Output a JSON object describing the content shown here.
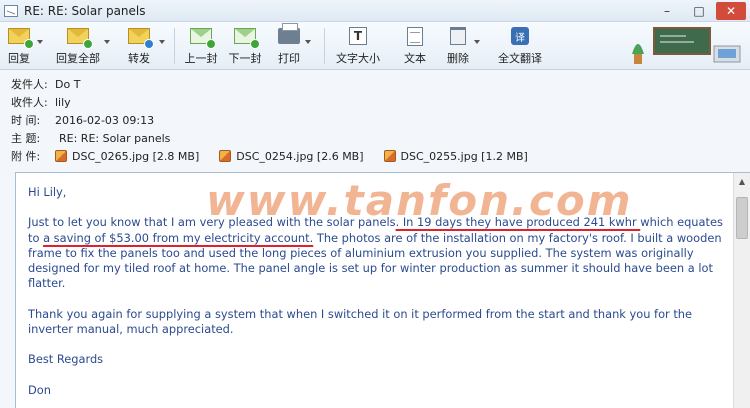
{
  "window": {
    "title": "RE:  RE:  Solar panels",
    "minimize": "–",
    "maximize": "□",
    "close": "✕"
  },
  "toolbar": {
    "reply": "回复",
    "reply_all": "回复全部",
    "forward": "转发",
    "prev": "上一封",
    "next": "下一封",
    "print": "打印",
    "font_size": "文字大小",
    "text": "文本",
    "delete": "删除",
    "translate": "全文翻译",
    "font_icon_glyph": "T",
    "translate_icon_glyph": "译"
  },
  "headers": {
    "from_label": "发件人:",
    "from_value": "Do  T  ",
    "to_label": "收件人:",
    "to_value": "lily",
    "time_label": "时   间:",
    "time_value": "2016-02-03 09:13",
    "subject_label": "主   题:",
    "subject_value": "RE:  RE:  Solar panels",
    "attach_label": "附   件:",
    "attachments": [
      {
        "name": "DSC_0265.jpg [2.8 MB]"
      },
      {
        "name": "DSC_0254.jpg [2.6 MB]"
      },
      {
        "name": "DSC_0255.jpg [1.2 MB]"
      }
    ]
  },
  "message": {
    "greeting": "Hi Lily,",
    "p1_a": "Just to let you know that I am very pleased with the solar panels",
    "p1_u1": ". In 19 days they have produced 241 kwhr ",
    "p1_b": " which equates to ",
    "p1_u2": "a saving of $53.00 from my electricity account.",
    "p1_c": " The photos are of the installation on my factory's roof. I built a wooden frame to fix the panels too and used the long pieces of aluminium extrusion you supplied. The system was originally designed for my tiled roof at home. The panel angle is set up for winter production as summer it should have been a lot flatter.",
    "p2": "Thank you again for supplying a system that when I switched it on it performed from the start and thank you for the inverter manual, much appreciated.",
    "closing": "Best Regards",
    "signature": "Don"
  },
  "watermark": "www.tanfon.com",
  "colors": {
    "body_text": "#2b4b8f",
    "underline": "#e0202a",
    "watermark": "#e8783c"
  }
}
